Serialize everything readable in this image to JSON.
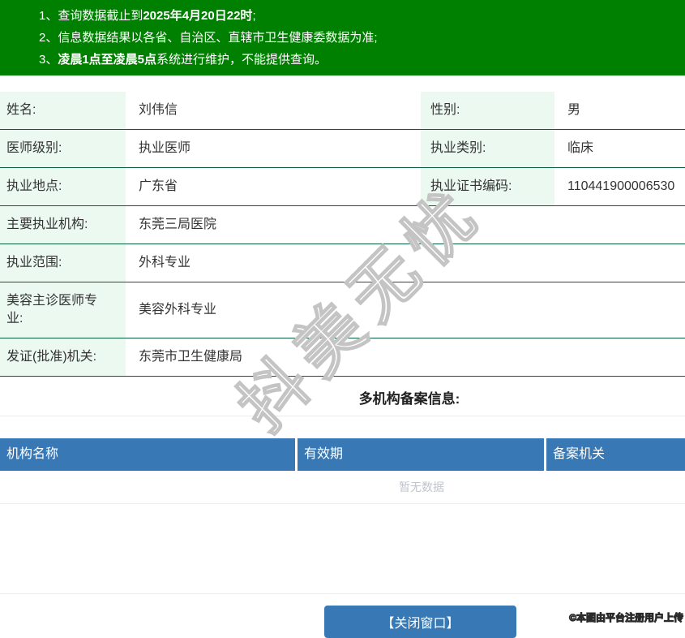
{
  "notice": {
    "lines": [
      {
        "pre": "1、查询数据截止到",
        "bold": "2025年4月20日22时",
        "post": ";"
      },
      {
        "pre": "2、信息数据结果以各省、自治区、直辖市卫生健康委数据为准;",
        "bold": "",
        "post": ""
      },
      {
        "pre": "3、",
        "bold": "凌晨1点至凌晨5点",
        "post": "系统进行维护，不能提供查询。"
      }
    ]
  },
  "info": {
    "rows": [
      {
        "label": "姓名:",
        "value": "刘伟信",
        "label2": "性别:",
        "value2": "男"
      },
      {
        "label": "医师级别:",
        "value": "执业医师",
        "label2": "执业类别:",
        "value2": "临床"
      },
      {
        "label": "执业地点:",
        "value": "广东省",
        "label2": "执业证书编码:",
        "value2": "110441900006530"
      },
      {
        "label": "主要执业机构:",
        "value": "东莞三局医院"
      },
      {
        "label": "执业范围:",
        "value": "外科专业"
      },
      {
        "label": "美容主诊医师专业:",
        "value": "美容外科专业"
      },
      {
        "label": "发证(批准)机关:",
        "value": "东莞市卫生健康局"
      }
    ]
  },
  "filing": {
    "title": "多机构备案信息:",
    "columns": [
      "机构名称",
      "有效期",
      "备案机关"
    ],
    "empty_text": "暂无数据"
  },
  "footer": {
    "close_button": "【关闭窗口】",
    "credit": "©本图由平台注册用户上传"
  },
  "watermark": "抖美无忧",
  "colors": {
    "banner_green": "#008000",
    "row_border_green": "#0b5e3b",
    "label_cell_bg": "#ebf9f1",
    "header_blue": "#3879b5",
    "button_blue": "#3879b5",
    "empty_text_gray": "#c0c4cc",
    "watermark_gray": "#c4c4c4"
  }
}
